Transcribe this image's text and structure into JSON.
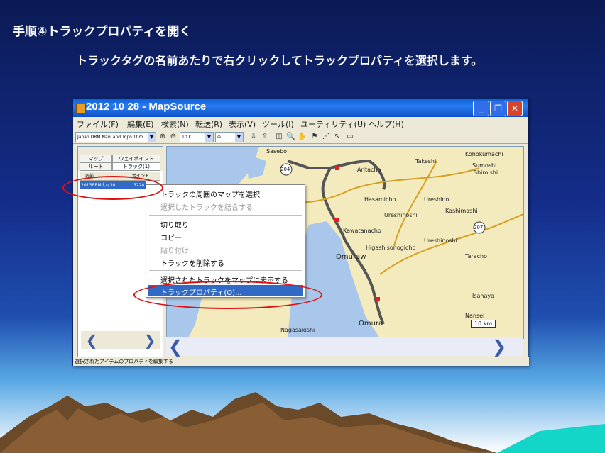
{
  "slide": {
    "title": "手順④トラックプロパティを開く",
    "subtitle": "トラックタグの名前あたりで右クリックしてトラックプロパティを選択します。"
  },
  "window": {
    "title": "2012 10 28 - MapSource",
    "controls": [
      "minimize",
      "maximize",
      "close"
    ]
  },
  "menubar": [
    "ファイル(F)",
    "編集(E)",
    "検索(N)",
    "転送(R)",
    "表示(V)",
    "ツール(I)",
    "ユーティリティ(U)",
    "ヘルプ(H)"
  ],
  "toolbar": {
    "map_select": "Japan DRM Navi and Topo 10m",
    "zoom_select": "10 k"
  },
  "panel": {
    "tabs": [
      "マップ",
      "ウェイポイント",
      "ルート",
      "トラック(1)"
    ],
    "columns": [
      "名前",
      "ポイント"
    ],
    "selected_track": {
      "name": "2013BRM大村30…",
      "points": "3224"
    }
  },
  "map": {
    "places": [
      "Sasebo",
      "Aritacho",
      "Takeshi",
      "Kohokumachi",
      "Sumoshi",
      "Shiroishi",
      "Hasamicho",
      "Ureshino",
      "Ureshinoshi",
      "Kashimashi",
      "Kawatanacho",
      "Ureshinoshi",
      "Higashisonogicho",
      "Omuraw",
      "Tara",
      "Taracho",
      "Isahaya",
      "Nagasakishi",
      "Omura",
      "Nansei"
    ],
    "scale": "10 km",
    "road_badges": [
      "204",
      "207"
    ]
  },
  "context_menu": {
    "items": [
      {
        "label": "トラックの周囲のマップを選択",
        "enabled": true
      },
      {
        "label": "選択したトラックを結合する",
        "enabled": false
      },
      {
        "label": "切り取り",
        "enabled": true
      },
      {
        "label": "コピー",
        "enabled": true
      },
      {
        "label": "貼り付け",
        "enabled": false
      },
      {
        "label": "トラックを削除する",
        "enabled": true
      },
      {
        "label": "選択されたトラックをマップに表示する",
        "enabled": true
      },
      {
        "label": "トラックプロパティ(O)...",
        "enabled": true,
        "selected": true
      }
    ]
  },
  "statusbar": "選択されたアイテムのプロパティを編集する",
  "colors": {
    "highlight": "#316ac5",
    "annotation": "#e01010",
    "titlebar": "#0a5fd9"
  }
}
